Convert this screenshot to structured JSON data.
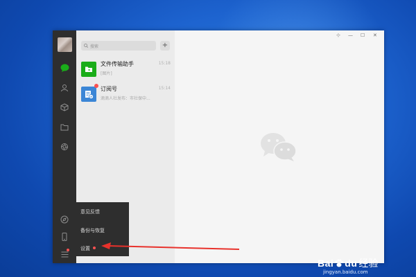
{
  "search": {
    "placeholder": "搜索",
    "plus": "+"
  },
  "chats": [
    {
      "name": "文件传输助手",
      "time": "15:18",
      "preview": "[图片]",
      "icon": "file-transfer-icon",
      "color": "#1aad19"
    },
    {
      "name": "订阅号",
      "time": "15:14",
      "preview": "滴滴人社发布：市社保中...",
      "icon": "subscription-icon",
      "color": "#3b86d6",
      "unread": true
    }
  ],
  "window_controls": [
    "⊹",
    "—",
    "☐",
    "✕"
  ],
  "menu": {
    "items": [
      "意见反馈",
      "备份与恢复",
      "设置"
    ]
  },
  "watermark": {
    "brand": "Bai",
    "brand2": "du",
    "cn": "经验",
    "url": "jingyan.baidu.com"
  },
  "colors": {
    "accent": "#1aad19",
    "alert": "#fa5151",
    "annotation": "#e8312b"
  }
}
